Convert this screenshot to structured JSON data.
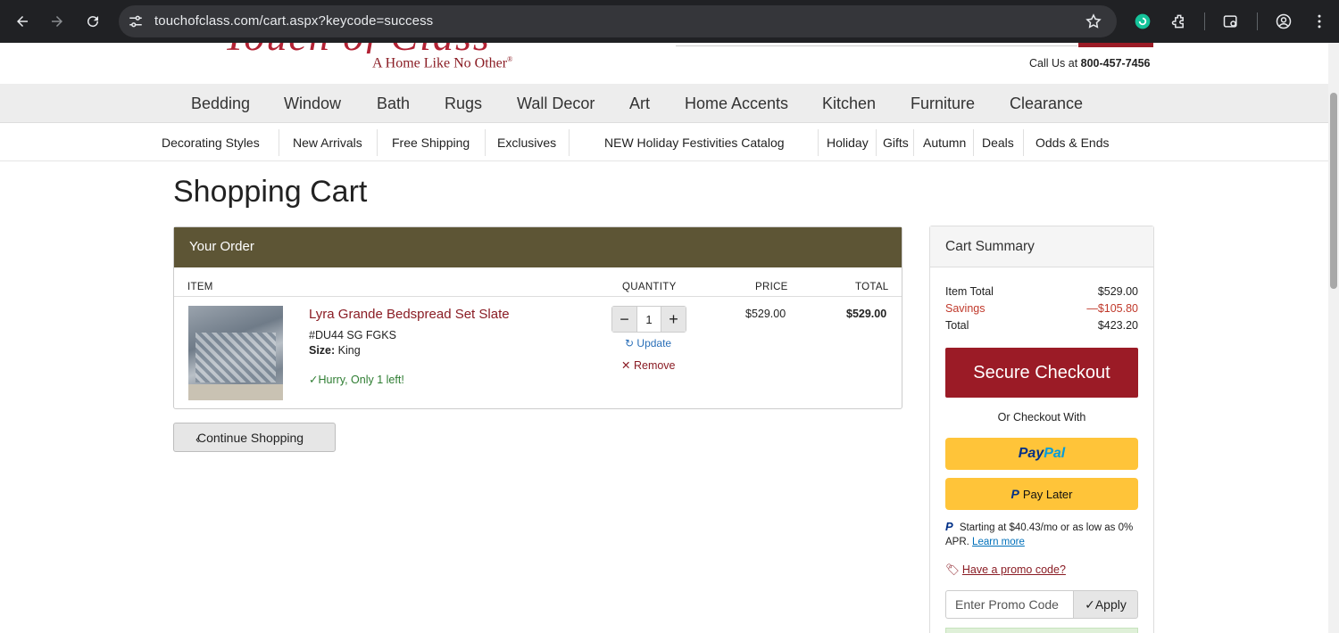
{
  "browser": {
    "url": "touchofclass.com/cart.aspx?keycode=success"
  },
  "header": {
    "tagline": "A Home Like No Other",
    "tagline_mark": "®",
    "call_label": "Call Us at ",
    "phone": "800-457-7456"
  },
  "main_nav": [
    "Bedding",
    "Window",
    "Bath",
    "Rugs",
    "Wall Decor",
    "Art",
    "Home Accents",
    "Kitchen",
    "Furniture",
    "Clearance"
  ],
  "sub_nav": [
    "Decorating Styles",
    "New Arrivals",
    "Free Shipping",
    "Exclusives",
    "NEW Holiday Festivities Catalog",
    "Holiday",
    "Gifts",
    "Autumn",
    "Deals",
    "Odds & Ends"
  ],
  "page_title": "Shopping Cart",
  "order": {
    "heading": "Your Order",
    "columns": {
      "item": "ITEM",
      "quantity": "QUANTITY",
      "price": "PRICE",
      "total": "TOTAL"
    },
    "item": {
      "name": "Lyra Grande Bedspread Set Slate",
      "sku": "#DU44 SG FGKS",
      "size_label": "Size:",
      "size_value": "King",
      "stock_note": "Hurry, Only 1 left!",
      "quantity": "1",
      "price": "$529.00",
      "total": "$529.00",
      "update_label": "Update",
      "remove_label": "Remove"
    }
  },
  "continue_label": "Continue Shopping",
  "summary": {
    "heading": "Cart Summary",
    "item_total_label": "Item Total",
    "item_total": "$529.00",
    "savings_label": "Savings",
    "savings": "—$105.80",
    "total_label": "Total",
    "total": "$423.20",
    "checkout_label": "Secure Checkout",
    "or_checkout_with": "Or Checkout With",
    "paypal_pay": "Pay",
    "paypal_pal": "Pal",
    "pay_later": "Pay Later",
    "financing_text": "Starting at $40.43/mo or as low as 0% APR.",
    "learn_more": "Learn more",
    "promo_link": "Have a promo code?",
    "promo_placeholder": "Enter Promo Code",
    "apply_label": "Apply"
  },
  "colors": {
    "brand_red": "#9b1b26",
    "order_header": "#5d5535",
    "paypal_yellow": "#ffc439",
    "stock_green": "#2e7d32"
  }
}
